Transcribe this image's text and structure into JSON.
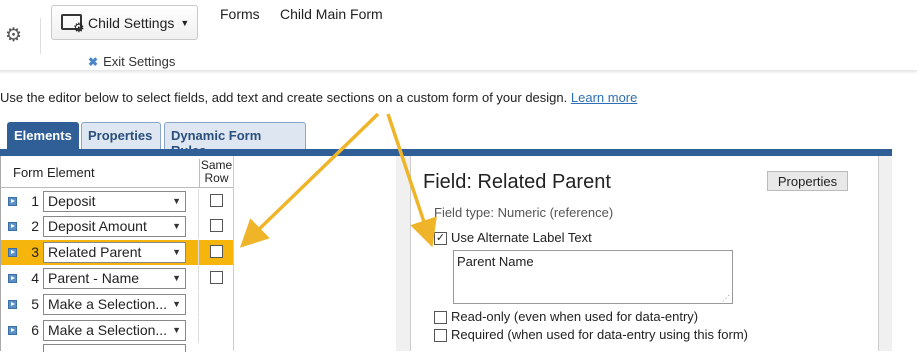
{
  "header": {
    "settings_button_label": "Child Settings",
    "nav_forms": "Forms",
    "nav_child_main_form": "Child Main Form",
    "exit_settings": "Exit Settings"
  },
  "intro": {
    "text": "Use the editor below to select fields, add text and create sections on a custom form of your design.",
    "learn_more": "Learn more"
  },
  "tabs": [
    {
      "label": "Elements",
      "active": true
    },
    {
      "label": "Properties",
      "active": false
    },
    {
      "label": "Dynamic Form Rules",
      "active": false
    }
  ],
  "element_list": {
    "col_form_element": "Form Element",
    "col_same_row_1": "Same",
    "col_same_row_2": "Row",
    "rows": [
      {
        "num": "1",
        "value": "Deposit",
        "same_row": false,
        "selected": false
      },
      {
        "num": "2",
        "value": "Deposit Amount",
        "same_row": false,
        "selected": false
      },
      {
        "num": "3",
        "value": "Related Parent",
        "same_row": false,
        "selected": true
      },
      {
        "num": "4",
        "value": "Parent - Name",
        "same_row": false,
        "selected": false
      },
      {
        "num": "5",
        "value": "Make a Selection...",
        "same_row": null,
        "selected": false
      },
      {
        "num": "6",
        "value": "Make a Selection...",
        "same_row": null,
        "selected": false
      }
    ]
  },
  "field_panel": {
    "title": "Field: Related Parent",
    "properties_button": "Properties",
    "field_type": "Field type: Numeric (reference)",
    "use_alt_label": {
      "label": "Use Alternate Label Text",
      "checked": true
    },
    "alt_label_value": "Parent Name",
    "read_only": {
      "label": "Read-only (even when used for data-entry)",
      "checked": false
    },
    "required": {
      "label": "Required (when used for data-entry using this form)",
      "checked": false
    }
  },
  "colors": {
    "tab_active": "#2f5f96",
    "selected_row": "#f5b50d",
    "annotation_arrow": "#f0b429",
    "link": "#2f6fb5"
  }
}
